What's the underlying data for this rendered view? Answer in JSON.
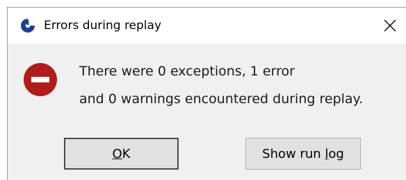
{
  "dialog": {
    "title": "Errors during replay",
    "icons": {
      "app": "replay-app-icon",
      "close": "close-icon",
      "status": "error-stop-icon"
    },
    "message": {
      "line1": "There were 0 exceptions, 1 error",
      "line2": "and 0 warnings encountered during replay."
    },
    "buttons": {
      "ok": {
        "mnemonic": "O",
        "rest": "K"
      },
      "show_log": {
        "before": "Show run ",
        "mnemonic": "l",
        "after": "og"
      }
    },
    "colors": {
      "error_red": "#b01c1c",
      "app_icon_blue": "#1f3f8f"
    }
  }
}
